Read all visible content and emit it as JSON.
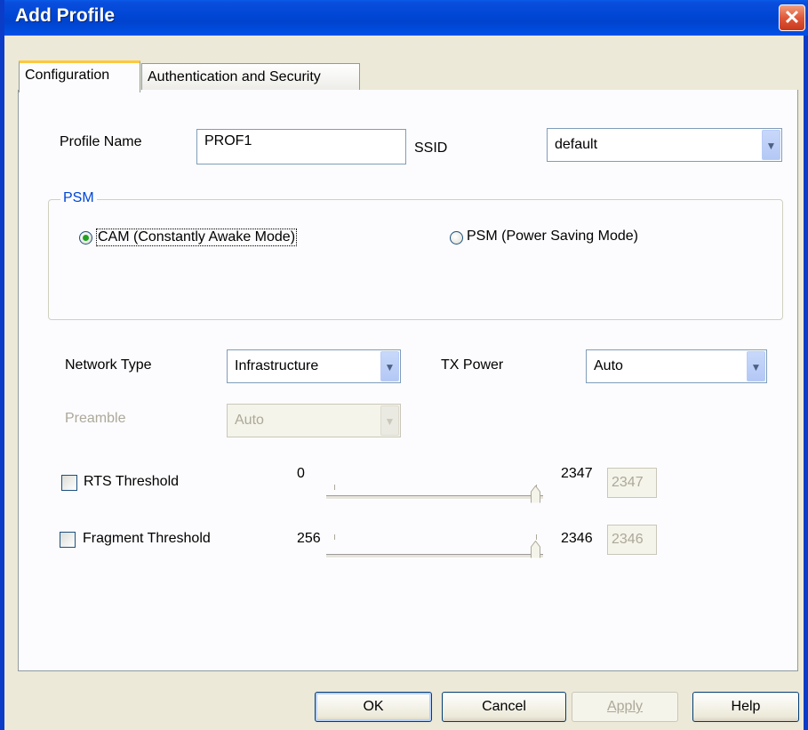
{
  "window": {
    "title": "Add Profile",
    "close_glyph": "✕"
  },
  "tabs": [
    {
      "label": "Configuration",
      "active": true
    },
    {
      "label": "Authentication and Security",
      "active": false
    }
  ],
  "profile": {
    "name_label": "Profile Name",
    "name_value": "PROF1",
    "ssid_label": "SSID",
    "ssid_value": "default"
  },
  "psm": {
    "legend": "PSM",
    "options": [
      {
        "label": "CAM (Constantly Awake Mode)",
        "selected": true
      },
      {
        "label": "PSM (Power Saving Mode)",
        "selected": false
      }
    ]
  },
  "network": {
    "type_label": "Network Type",
    "type_value": "Infrastructure",
    "tx_label": "TX Power",
    "tx_value": "Auto",
    "preamble_label": "Preamble",
    "preamble_value": "Auto"
  },
  "rts": {
    "label": "RTS Threshold",
    "checked": false,
    "min": "0",
    "max": "2347",
    "value": "2347"
  },
  "fragment": {
    "label": "Fragment Threshold",
    "checked": false,
    "min": "256",
    "max": "2346",
    "value": "2346"
  },
  "buttons": {
    "ok": "OK",
    "cancel": "Cancel",
    "apply": "Apply",
    "help": "Help"
  },
  "icons": {
    "dropdown": "chevron-down-icon",
    "close": "close-icon"
  },
  "colors": {
    "titlebar": "#0046d5",
    "close_button": "#e0583a",
    "tab_highlight": "#ffc83c",
    "group_legend": "#0046d5",
    "radio_dot": "#21a121"
  }
}
